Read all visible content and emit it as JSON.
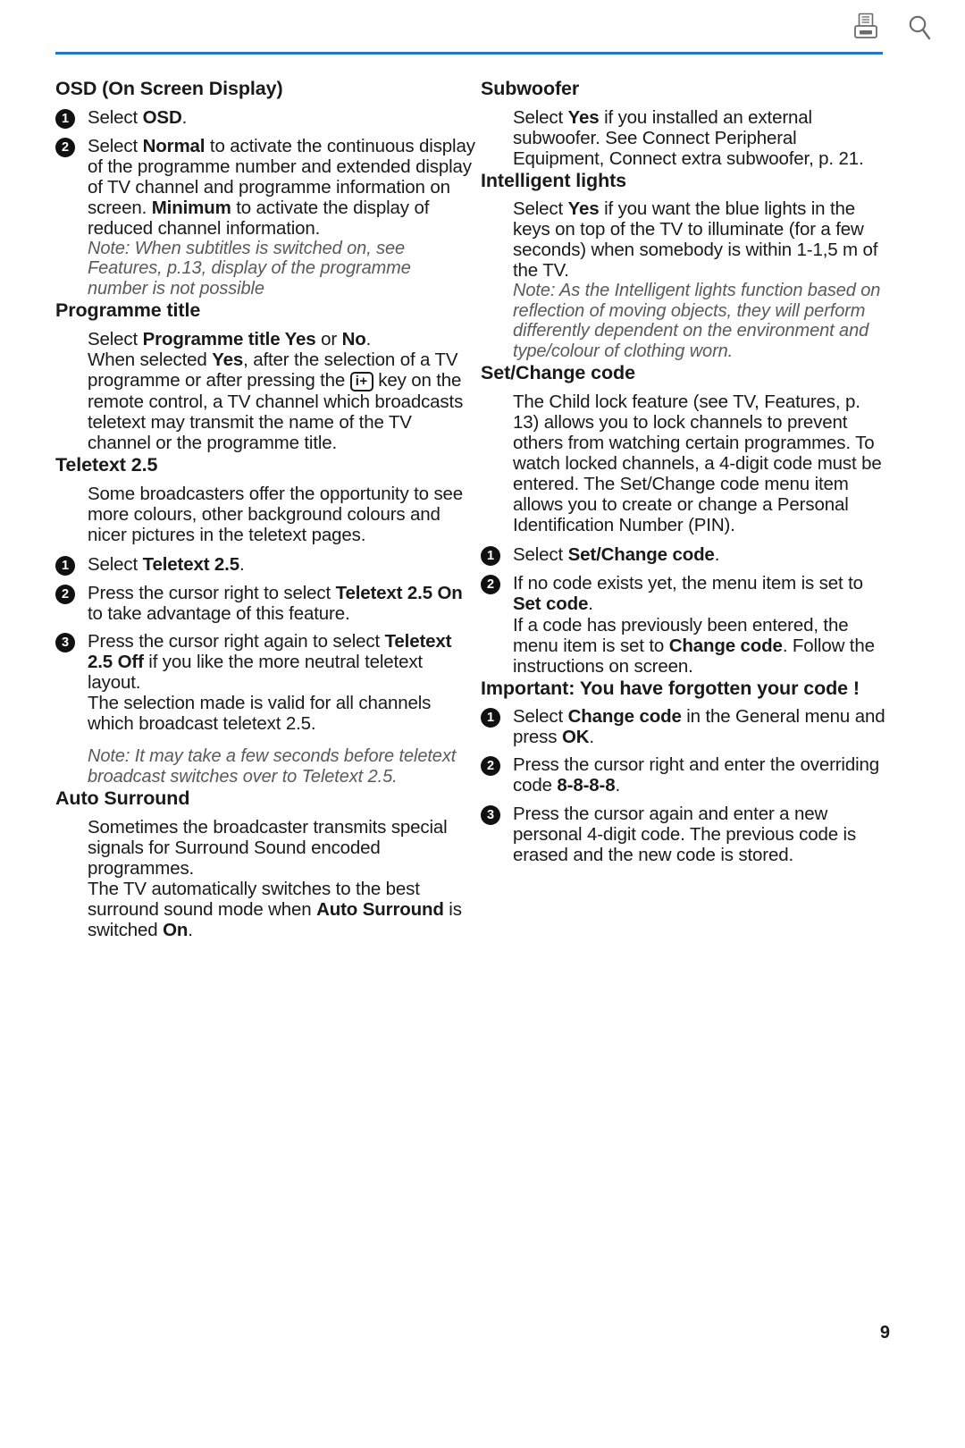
{
  "toolbar": {
    "print_icon": "printer-icon",
    "search_icon": "search-icon",
    "rule_color": "#2277c8"
  },
  "left_column": {
    "osd": {
      "heading": "OSD (On Screen Display)",
      "steps": [
        {
          "num": "1",
          "pre": "Select ",
          "bold": "OSD",
          "post": "."
        },
        {
          "num": "2",
          "text_html": "Select <b>Normal</b> to activate the continuous display of the programme number and extended display of TV channel and programme information on screen. <b>Minimum</b> to activate the display of reduced channel information."
        }
      ],
      "note": "Note: When subtitles is switched on, see Features, p.13, display of the programme number is not possible"
    },
    "programme_title": {
      "heading": "Programme title",
      "body_html": "Select <b>Programme title  Yes</b> or <b>No</b>.<br>When selected <b>Yes</b>, after the selection of a TV programme or after pressing the <span class=\"key-glyph\">i+</span> key on the remote control, a TV channel which broadcasts teletext may transmit the name of the TV channel or the programme title."
    },
    "teletext": {
      "heading": "Teletext 2.5",
      "body": "Some broadcasters offer the opportunity to see more colours, other background colours and nicer pictures in the teletext pages.",
      "steps": [
        {
          "num": "1",
          "text_html": "Select <b>Teletext 2.5</b>."
        },
        {
          "num": "2",
          "text_html": "Press the cursor right to select <b>Teletext 2.5 On</b> to take advantage of this feature."
        },
        {
          "num": "3",
          "text_html": "Press the cursor right again to select <b>Teletext 2.5 Off</b> if you like the more neutral teletext layout.<br>The selection made is valid for all channels which broadcast teletext 2.5."
        }
      ],
      "note": "Note: It may take a few seconds before teletext broadcast switches over to Teletext 2.5."
    },
    "auto_surround": {
      "heading": "Auto Surround",
      "body_html": "Sometimes the broadcaster transmits special signals for Surround Sound encoded programmes.<br>The TV automatically switches to the best surround sound mode when <b>Auto Surround</b> is switched <b>On</b>."
    }
  },
  "right_column": {
    "subwoofer": {
      "heading": "Subwoofer",
      "body_html": "Select <b>Yes</b> if you installed an external subwoofer. See Connect Peripheral Equipment, Connect extra subwoofer, p. 21."
    },
    "intelligent_lights": {
      "heading": "Intelligent lights",
      "body_html": "Select <b>Yes</b> if you want the blue lights in the keys on top of the TV to illuminate (for a few seconds) when somebody is within 1-1,5 m of the TV.",
      "note": "Note: As the Intelligent lights function based on reflection of moving objects, they will perform differently dependent on the environment and type/colour of clothing worn."
    },
    "set_change_code": {
      "heading": "Set/Change code",
      "body": "The Child lock feature (see TV, Features, p. 13) allows you to lock channels to prevent others from watching certain programmes. To watch locked channels, a 4-digit code must be entered. The Set/Change code menu item allows you to create or change a Personal Identification Number (PIN).",
      "steps": [
        {
          "num": "1",
          "text_html": "Select <b>Set/Change code</b>."
        },
        {
          "num": "2",
          "text_html": "If no code exists yet, the menu item is set to <b>Set code</b>.<br>If a code has previously been entered, the menu item is set to <b>Change code</b>. Follow the instructions on screen."
        }
      ]
    },
    "important": {
      "heading": "Important: You have forgotten your code !",
      "steps": [
        {
          "num": "1",
          "text_html": "Select <b>Change code</b> in the General menu and press <b>OK</b>."
        },
        {
          "num": "2",
          "text_html": "Press the cursor right and enter the overriding code <b>8-8-8-8</b>."
        },
        {
          "num": "3",
          "text_html": "Press the cursor again and enter a new personal 4-digit code. The previous code is erased and the new code is stored."
        }
      ]
    }
  },
  "footer": {
    "page_number": "9"
  }
}
